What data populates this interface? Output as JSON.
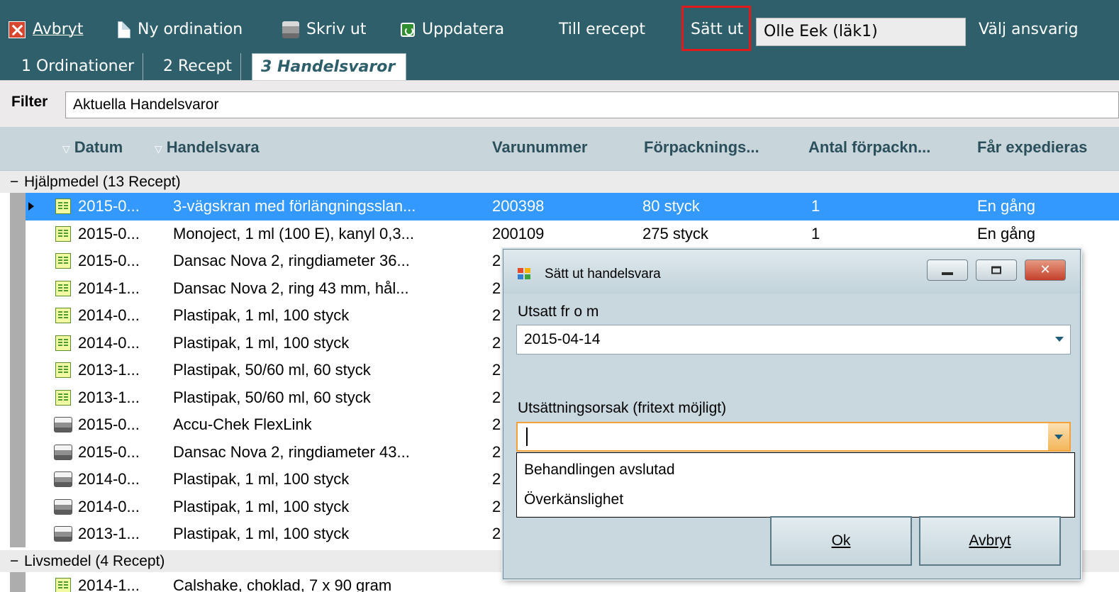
{
  "toolbar": {
    "cancel_label": "Avbryt",
    "new_order_label": "Ny ordination",
    "print_label": "Skriv ut",
    "update_label": "Uppdatera",
    "erecept_label": "Till erecept",
    "discontinue_label": "Sätt ut",
    "prescriber_value": "Olle Eek (läk1)",
    "choose_responsible_label": "Välj ansvarig"
  },
  "tabs": [
    {
      "label": "1 Ordinationer",
      "active": false
    },
    {
      "label": "2 Recept",
      "active": false
    },
    {
      "label": "3 Handelsvaror",
      "active": true
    }
  ],
  "filter": {
    "label": "Filter",
    "value": "Aktuella Handelsvaror"
  },
  "columns": {
    "date": "Datum",
    "product": "Handelsvara",
    "item_number": "Varunummer",
    "package": "Förpacknings...",
    "package_count": "Antal förpackn...",
    "dispense": "Får expedieras"
  },
  "groups": [
    {
      "label": "Hjälpmedel (13 Recept)"
    },
    {
      "label": "Livsmedel (4 Recept)"
    }
  ],
  "rows": [
    {
      "icon": "prescription-icon",
      "date": "2015-0...",
      "product": "3-vägskran med förlängningsslan...",
      "item_number": "200398",
      "package": "80 styck",
      "count": "1",
      "dispense": "En gång",
      "selected": true
    },
    {
      "icon": "prescription-icon",
      "date": "2015-0...",
      "product": "Monoject, 1 ml (100 E), kanyl 0,3...",
      "item_number": "200109",
      "package": "275 styck",
      "count": "1",
      "dispense": "En gång",
      "selected": false
    },
    {
      "icon": "prescription-icon",
      "date": "2015-0...",
      "product": "Dansac Nova 2, ringdiameter 36...",
      "item_number": "2",
      "package": "",
      "count": "",
      "dispense": "",
      "selected": false
    },
    {
      "icon": "prescription-icon",
      "date": "2014-1...",
      "product": "Dansac Nova 2, ring 43 mm, hål...",
      "item_number": "2",
      "package": "",
      "count": "",
      "dispense": "",
      "selected": false
    },
    {
      "icon": "prescription-icon",
      "date": "2014-0...",
      "product": "Plastipak, 1 ml, 100 styck",
      "item_number": "2",
      "package": "",
      "count": "",
      "dispense": "",
      "selected": false
    },
    {
      "icon": "prescription-icon",
      "date": "2014-0...",
      "product": "Plastipak, 1 ml, 100 styck",
      "item_number": "2",
      "package": "",
      "count": "",
      "dispense": "",
      "selected": false
    },
    {
      "icon": "prescription-icon",
      "date": "2013-1...",
      "product": "Plastipak, 50/60 ml, 60 styck",
      "item_number": "2",
      "package": "",
      "count": "",
      "dispense": "",
      "selected": false
    },
    {
      "icon": "prescription-icon",
      "date": "2013-1...",
      "product": "Plastipak, 50/60 ml, 60 styck",
      "item_number": "2",
      "package": "",
      "count": "",
      "dispense": "",
      "selected": false
    },
    {
      "icon": "printer-icon",
      "date": "2015-0...",
      "product": "Accu-Chek FlexLink",
      "item_number": "2",
      "package": "",
      "count": "",
      "dispense": "",
      "selected": false
    },
    {
      "icon": "printer-icon",
      "date": "2015-0...",
      "product": "Dansac Nova 2, ringdiameter 43...",
      "item_number": "2",
      "package": "",
      "count": "",
      "dispense": "",
      "selected": false
    },
    {
      "icon": "printer-icon",
      "date": "2014-0...",
      "product": "Plastipak, 1 ml, 100 styck",
      "item_number": "2",
      "package": "",
      "count": "",
      "dispense": "",
      "selected": false
    },
    {
      "icon": "printer-icon",
      "date": "2014-0...",
      "product": "Plastipak, 1 ml, 100 styck",
      "item_number": "2",
      "package": "",
      "count": "",
      "dispense": "",
      "selected": false
    },
    {
      "icon": "printer-icon",
      "date": "2013-1...",
      "product": "Plastipak, 1 ml, 100 styck",
      "item_number": "2",
      "package": "",
      "count": "",
      "dispense": "",
      "selected": false
    }
  ],
  "partial_row": {
    "date": "2014-1...",
    "product": "Calshake, choklad, 7 x 90 gram"
  },
  "dialog": {
    "title": "Sätt ut handelsvara",
    "from_label": "Utsatt fr o m",
    "from_value": "2015-04-14",
    "reason_label": "Utsättningsorsak (fritext möjligt)",
    "reason_value": "",
    "options": [
      "Behandlingen avslutad",
      "Överkänslighet"
    ],
    "ok_label": "Ok",
    "cancel_label": "Avbryt"
  },
  "colors": {
    "toolbar_bg": "#2e5f6b",
    "selected_row": "#3399ff",
    "highlight_box": "#e01b1b",
    "dialog_bg": "#c9d8de",
    "focus_border": "#f3a33a"
  }
}
